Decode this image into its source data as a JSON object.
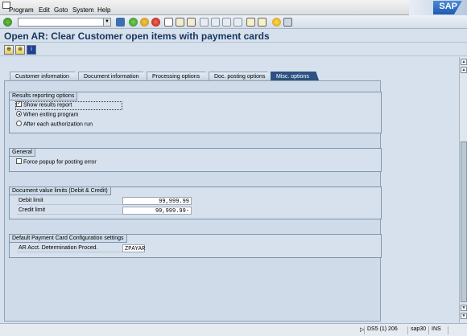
{
  "menu": {
    "items": [
      "Program",
      "Edit",
      "Goto",
      "System",
      "Help"
    ]
  },
  "logo_text": "SAP",
  "title": "Open AR: Clear Customer open items with payment cards",
  "tabs": [
    {
      "label": "Customer information",
      "active": false
    },
    {
      "label": "Document information",
      "active": false
    },
    {
      "label": "Processing options",
      "active": false
    },
    {
      "label": "Doc. posting options",
      "active": false
    },
    {
      "label": "Misc. options",
      "active": true
    }
  ],
  "groups": {
    "results": {
      "title": "Results reporting options",
      "show_results": "Show results report",
      "when_exiting": "When exiting program",
      "after_each": "After each authorization run"
    },
    "general": {
      "title": "General",
      "force_popup": "Force popup for posting error"
    },
    "limits": {
      "title": "Document value limits (Debit & Credit)",
      "debit_label": "Debit limit",
      "debit_value": "99,999.99",
      "credit_label": "Credit limit",
      "credit_value": "99,999.99-"
    },
    "payment_card": {
      "title": "Default Payment Card Configuration settings",
      "ar_label": "AR Acct. Determination Proced.",
      "ar_value": "ZPAYAR"
    }
  },
  "status": {
    "session": "DS5 (1) 206",
    "server": "sap30",
    "mode": "INS"
  },
  "colors": {
    "active_tab": "#2d5180",
    "background": "#d6e1ed",
    "title": "#17365d"
  }
}
